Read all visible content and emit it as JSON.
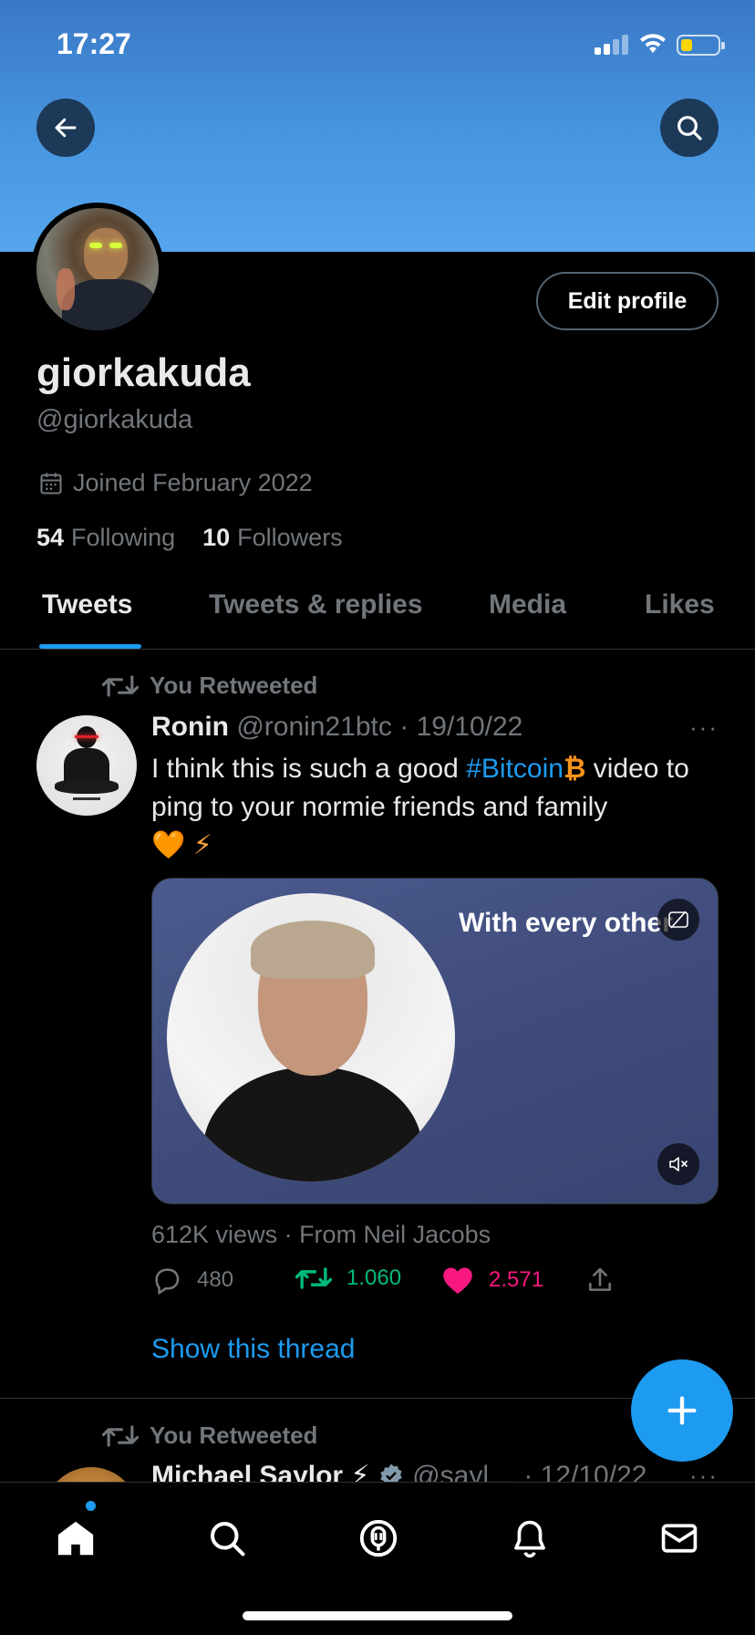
{
  "status_bar": {
    "time": "17:27"
  },
  "profile": {
    "display_name": "giorkakuda",
    "handle": "@giorkakuda",
    "joined": "Joined February 2022",
    "following_count": "54",
    "following_label": "Following",
    "followers_count": "10",
    "followers_label": "Followers",
    "edit_label": "Edit profile"
  },
  "tabs": [
    {
      "label": "Tweets",
      "active": true
    },
    {
      "label": "Tweets & replies"
    },
    {
      "label": "Media"
    },
    {
      "label": "Likes"
    }
  ],
  "tweets": [
    {
      "retweet_label": "You Retweeted",
      "author_name": "Ronin",
      "author_handle": "@ronin21btc",
      "date_sep": "·",
      "date": "19/10/22",
      "more": "···",
      "text_before": "I think this is such a good ",
      "hashtag": "#Bitcoin",
      "bitcoin_emoji": "₿",
      "text_after": " video to ping to your normie friends and family",
      "emojis": "🧡 ⚡",
      "media_caption": "With every other",
      "views": "612K views · From Neil Jacobs",
      "replies": "480",
      "retweets": "1.060",
      "likes": "2.571",
      "thread_link": "Show this thread",
      "colors": {
        "retweet": "#00ba7c",
        "like": "#f91880",
        "link": "#1d9bf0"
      }
    },
    {
      "retweet_label": "You Retweeted",
      "author_name": "Michael Saylor ⚡",
      "author_handle": "@sayl…",
      "date": "· 12/10/22",
      "more": "···"
    }
  ],
  "icons": {
    "back": "back-arrow-icon",
    "search": "search-icon",
    "calendar": "calendar-icon",
    "retweet": "retweet-icon",
    "reply": "reply-icon",
    "like": "heart-icon",
    "share": "share-icon",
    "compose": "plus-icon"
  },
  "colors": {
    "accent": "#1d9bf0",
    "banner": "#4796e0",
    "muted": "#71767b"
  }
}
